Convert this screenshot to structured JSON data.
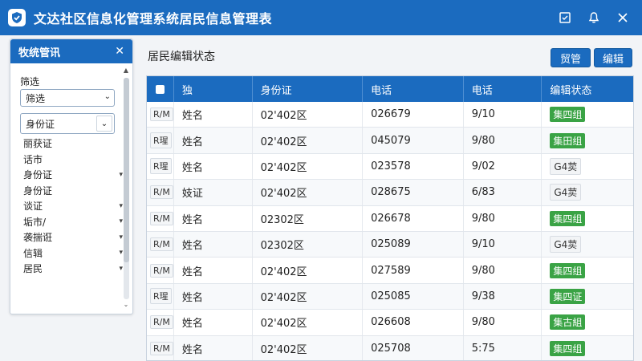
{
  "window": {
    "title": "文达社区信息化管理系统居民信息管理表"
  },
  "sidebar": {
    "header": "牧统管讯",
    "filter_label": "筛选",
    "filter_select": "筛选",
    "id_select": "身份证",
    "items": [
      {
        "label": "丽获证",
        "chevron": false
      },
      {
        "label": "话市",
        "chevron": false
      },
      {
        "label": "身份证",
        "chevron": true
      },
      {
        "label": "身份证",
        "chevron": false
      },
      {
        "label": "谈证",
        "chevron": true
      },
      {
        "label": "垢市/",
        "chevron": true
      },
      {
        "label": "袭揣诳",
        "chevron": true
      },
      {
        "label": "信辑",
        "chevron": true
      },
      {
        "label": "居民",
        "chevron": true
      }
    ]
  },
  "main": {
    "title": "居民编辑状态",
    "button_1": "贸管",
    "button_2": "编辑"
  },
  "table": {
    "headers": [
      "独",
      "身份证",
      "电话",
      "电话",
      "编辑状态"
    ],
    "rows": [
      {
        "tag": "R/M",
        "name": "姓名",
        "id": "02'402区",
        "phone": "026679",
        "date": "9/10",
        "status": "集四组",
        "status_type": "green"
      },
      {
        "tag": "R瑆",
        "name": "姓名",
        "id": "02'402区",
        "phone": "045079",
        "date": "9/80",
        "status": "集田组",
        "status_type": "green"
      },
      {
        "tag": "R瑆",
        "name": "姓名",
        "id": "02'402区",
        "phone": "023578",
        "date": "9/02",
        "status": "G4荬",
        "status_type": "gray"
      },
      {
        "tag": "R/M",
        "name": "妓证",
        "id": "02'402区",
        "phone": "028675",
        "date": "6/83",
        "status": "G4荬",
        "status_type": "gray"
      },
      {
        "tag": "R/M",
        "name": "姓名",
        "id": "02302区",
        "phone": "026678",
        "date": "9/80",
        "status": "集四组",
        "status_type": "green"
      },
      {
        "tag": "R/M",
        "name": "姓名",
        "id": "02302区",
        "phone": "025089",
        "date": "9/10",
        "status": "G4荬",
        "status_type": "gray"
      },
      {
        "tag": "R/M",
        "name": "姓名",
        "id": "02'402区",
        "phone": "027589",
        "date": "9/80",
        "status": "集四组",
        "status_type": "green"
      },
      {
        "tag": "R瑆",
        "name": "姓名",
        "id": "02'402区",
        "phone": "025085",
        "date": "9/38",
        "status": "集四证",
        "status_type": "green"
      },
      {
        "tag": "R/M",
        "name": "姓名",
        "id": "02'402区",
        "phone": "026608",
        "date": "9/80",
        "status": "集古組",
        "status_type": "green"
      },
      {
        "tag": "R/M",
        "name": "姓名",
        "id": "02'402区",
        "phone": "025708",
        "date": "5:75",
        "status": "集四组",
        "status_type": "green"
      }
    ]
  },
  "icons": {
    "app": "shield-check-icon",
    "titlebar": [
      "restore-icon",
      "bell-icon",
      "close-icon"
    ]
  },
  "colors": {
    "primary": "#1b6bbf",
    "status_green": "#3aa345"
  }
}
